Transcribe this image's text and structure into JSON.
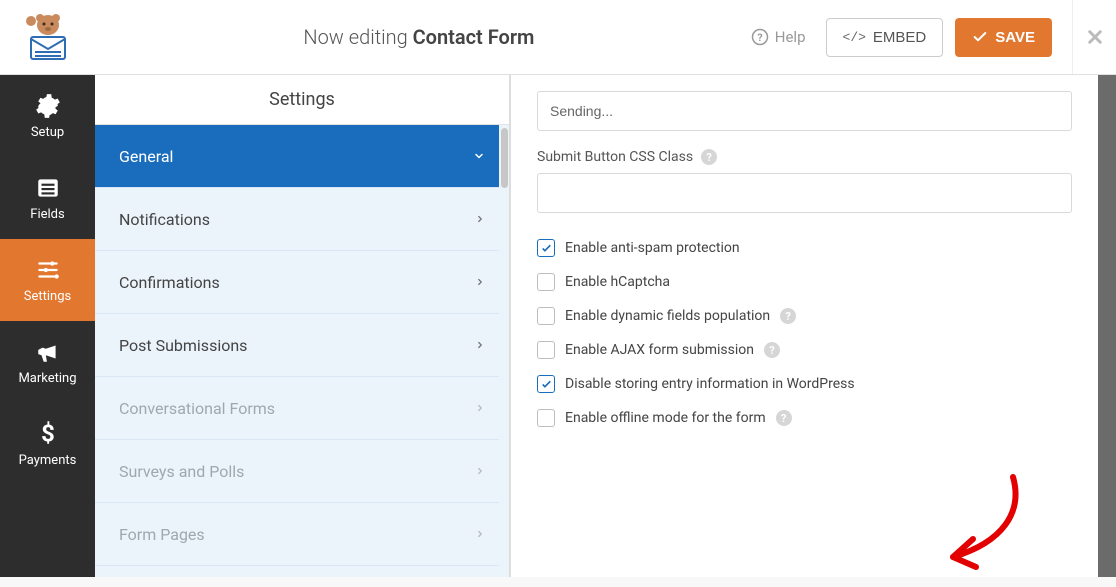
{
  "topbar": {
    "editing_prefix": "Now editing ",
    "form_name": "Contact Form",
    "help_label": "Help",
    "embed_label": "EMBED",
    "save_label": "SAVE"
  },
  "sidebar": {
    "items": [
      {
        "label": "Setup",
        "icon": "gear-icon"
      },
      {
        "label": "Fields",
        "icon": "list-icon"
      },
      {
        "label": "Settings",
        "icon": "sliders-icon",
        "active": true
      },
      {
        "label": "Marketing",
        "icon": "bullhorn-icon"
      },
      {
        "label": "Payments",
        "icon": "dollar-icon"
      }
    ]
  },
  "subpanel": {
    "title": "Settings",
    "items": [
      {
        "label": "General",
        "active": true,
        "expanded": true
      },
      {
        "label": "Notifications"
      },
      {
        "label": "Confirmations"
      },
      {
        "label": "Post Submissions"
      },
      {
        "label": "Conversational Forms",
        "disabled": true
      },
      {
        "label": "Surveys and Polls",
        "disabled": true
      },
      {
        "label": "Form Pages",
        "disabled": true
      }
    ]
  },
  "form": {
    "sending_value": "Sending...",
    "css_class_label": "Submit Button CSS Class",
    "css_class_value": "",
    "checkboxes": [
      {
        "label": "Enable anti-spam protection",
        "checked": true,
        "help": false
      },
      {
        "label": "Enable hCaptcha",
        "checked": false,
        "help": false
      },
      {
        "label": "Enable dynamic fields population",
        "checked": false,
        "help": true
      },
      {
        "label": "Enable AJAX form submission",
        "checked": false,
        "help": true
      },
      {
        "label": "Disable storing entry information in WordPress",
        "checked": true,
        "help": false
      },
      {
        "label": "Enable offline mode for the form",
        "checked": false,
        "help": true
      }
    ]
  }
}
